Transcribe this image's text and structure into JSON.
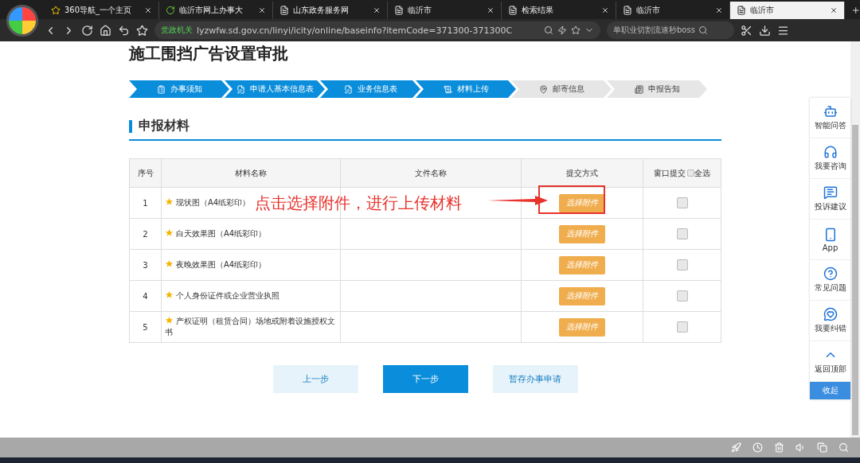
{
  "browser": {
    "tabs": [
      {
        "title": "360导航_一个主页",
        "selected": false
      },
      {
        "title": "临沂市网上办事大",
        "selected": false
      },
      {
        "title": "山东政务服务网",
        "selected": false
      },
      {
        "title": "临沂市",
        "selected": false
      },
      {
        "title": "检索结果",
        "selected": false
      },
      {
        "title": "临沂市",
        "selected": false
      },
      {
        "title": "临沂市",
        "selected": true
      }
    ],
    "address": {
      "badge": "党政机关",
      "url": "lyzwfw.sd.gov.cn/linyi/icity/online/baseinfo?itemCode=371300-371300C"
    },
    "search": {
      "value": "单职业切割流速秒boss"
    }
  },
  "page": {
    "title": "施工围挡广告设置审批",
    "steps": [
      {
        "label": "办事须知",
        "done": true
      },
      {
        "label": "申请人基本信息表",
        "done": true
      },
      {
        "label": "业务信息表",
        "done": true
      },
      {
        "label": "材料上传",
        "done": true
      },
      {
        "label": "邮寄信息",
        "done": false
      },
      {
        "label": "申报告知",
        "done": false
      }
    ],
    "section_title": "申报材料",
    "table": {
      "columns": [
        "序号",
        "材料名称",
        "文件名称",
        "提交方式",
        "窗口提交"
      ],
      "select_all": {
        "label": "全选",
        "checked": false
      },
      "rows": [
        {
          "index": "1",
          "name": "现状图（A4纸彩印）",
          "required": true,
          "button": "选择附件",
          "checked": false
        },
        {
          "index": "2",
          "name": "白天效果图（A4纸彩印）",
          "required": true,
          "button": "选择附件",
          "checked": false
        },
        {
          "index": "3",
          "name": "夜晚效果图（A4纸彩印）",
          "required": true,
          "button": "选择附件",
          "checked": false
        },
        {
          "index": "4",
          "name": "个人身份证件或企业营业执照",
          "required": true,
          "button": "选择附件",
          "checked": false
        },
        {
          "index": "5",
          "name": "产权证明（租赁合同）场地或附着设施授权文书",
          "required": true,
          "button": "选择附件",
          "checked": false
        }
      ]
    },
    "annotation": {
      "text": "点击选择附件，进行上传材料"
    },
    "buttons": [
      {
        "label": "上一步",
        "kind": "secondary"
      },
      {
        "label": "下一步",
        "kind": "primary"
      },
      {
        "label": "暂存办事申请",
        "kind": "secondary"
      }
    ]
  },
  "sidebar": {
    "items": [
      {
        "label": "智能问答"
      },
      {
        "label": "我要咨询"
      },
      {
        "label": "投诉建议"
      },
      {
        "label": "App"
      },
      {
        "label": "常见问题"
      },
      {
        "label": "我要纠错"
      },
      {
        "label": "返回顶部"
      }
    ],
    "collapse": "收起"
  }
}
